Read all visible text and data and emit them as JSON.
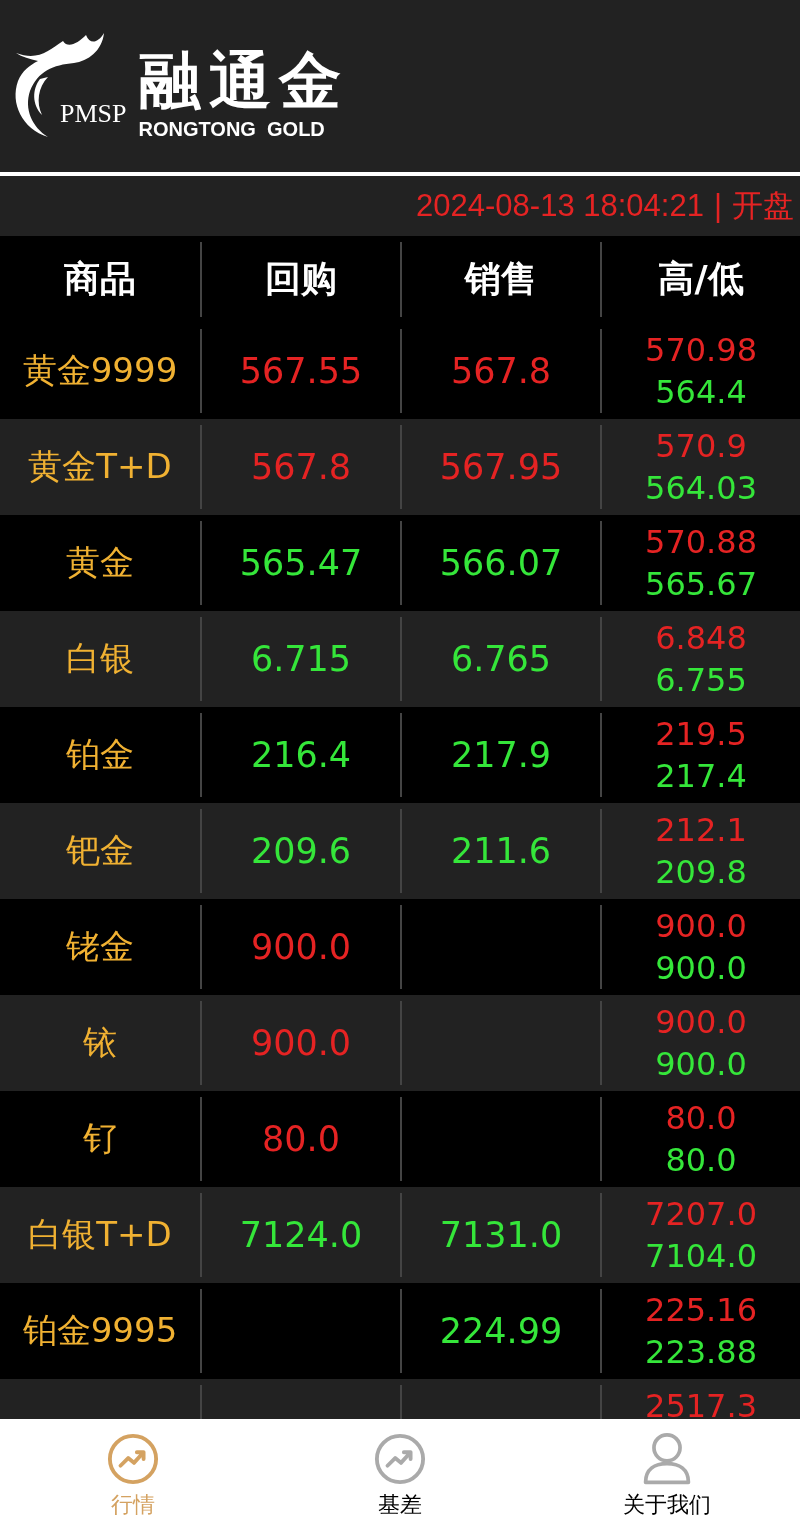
{
  "brand": {
    "mark": "PMSP",
    "name": "融通金",
    "subtitle": "RONGTONG  GOLD"
  },
  "status": {
    "datetime": "2024-08-13 18:04:21",
    "separator": "|",
    "state": "开盘"
  },
  "table": {
    "columns": [
      "商品",
      "回购",
      "销售",
      "高/低"
    ],
    "rows": [
      {
        "name": "黄金9999",
        "buy": {
          "text": "567.55",
          "color": "#e52323"
        },
        "sell": {
          "text": "567.8",
          "color": "#e52323"
        },
        "high": "570.98",
        "low": "564.4"
      },
      {
        "name": "黄金T+D",
        "buy": {
          "text": "567.8",
          "color": "#e52323"
        },
        "sell": {
          "text": "567.95",
          "color": "#e52323"
        },
        "high": "570.9",
        "low": "564.03"
      },
      {
        "name": "黄金",
        "buy": {
          "text": "565.47",
          "color": "#35e63a"
        },
        "sell": {
          "text": "566.07",
          "color": "#35e63a"
        },
        "high": "570.88",
        "low": "565.67"
      },
      {
        "name": "白银",
        "buy": {
          "text": "6.715",
          "color": "#35e63a"
        },
        "sell": {
          "text": "6.765",
          "color": "#35e63a"
        },
        "high": "6.848",
        "low": "6.755"
      },
      {
        "name": "铂金",
        "buy": {
          "text": "216.4",
          "color": "#35e63a"
        },
        "sell": {
          "text": "217.9",
          "color": "#35e63a"
        },
        "high": "219.5",
        "low": "217.4"
      },
      {
        "name": "钯金",
        "buy": {
          "text": "209.6",
          "color": "#35e63a"
        },
        "sell": {
          "text": "211.6",
          "color": "#35e63a"
        },
        "high": "212.1",
        "low": "209.8"
      },
      {
        "name": "铑金",
        "buy": {
          "text": "900.0",
          "color": "#e52323"
        },
        "high": "900.0",
        "low": "900.0"
      },
      {
        "name": "铱",
        "buy": {
          "text": "900.0",
          "color": "#e52323"
        },
        "high": "900.0",
        "low": "900.0"
      },
      {
        "name": "钌",
        "buy": {
          "text": "80.0",
          "color": "#e52323"
        },
        "high": "80.0",
        "low": "80.0"
      },
      {
        "name": "白银T+D",
        "buy": {
          "text": "7124.0",
          "color": "#35e63a"
        },
        "sell": {
          "text": "7131.0",
          "color": "#35e63a"
        },
        "high": "7207.0",
        "low": "7104.0"
      },
      {
        "name": "铂金9995",
        "sell": {
          "text": "224.99",
          "color": "#35e63a"
        },
        "high": "225.16",
        "low": "223.88"
      },
      {
        "high": "2517.3"
      }
    ]
  },
  "nav": [
    {
      "label": "行情",
      "kind": "chart",
      "selected": true
    },
    {
      "label": "基差",
      "kind": "chart",
      "selected": false
    },
    {
      "label": "关于我们",
      "kind": "person",
      "selected": false
    }
  ]
}
